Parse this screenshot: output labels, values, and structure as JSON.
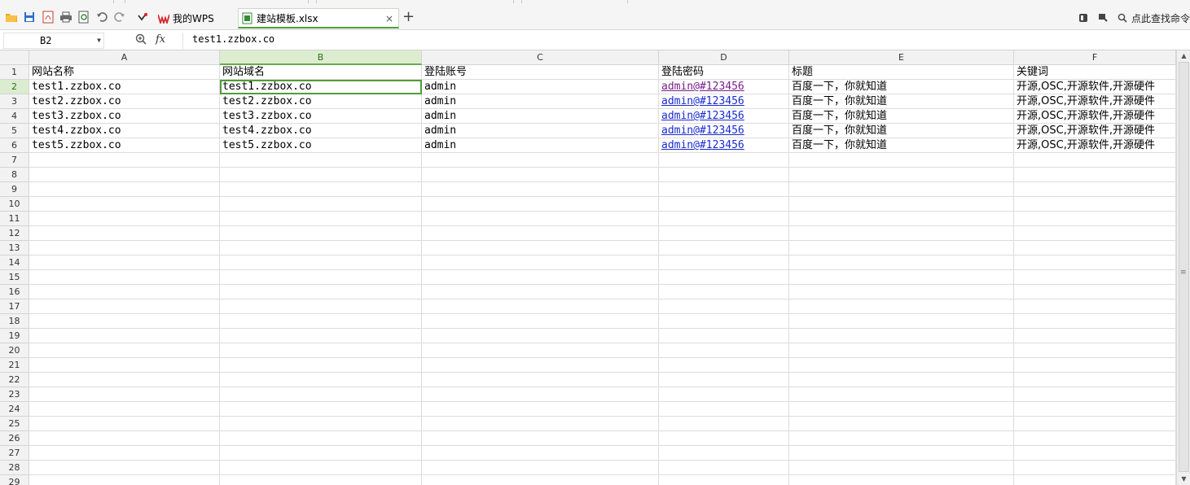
{
  "tabs": {
    "home_label": "我的WPS",
    "file_label": "建站模板.xlsx",
    "close_glyph": "×",
    "new_glyph": "+"
  },
  "toolbar": {
    "search_label": "点此查找命令"
  },
  "formula_bar": {
    "name_box": "B2",
    "fx_label": "fx",
    "content": "test1.zzbox.co"
  },
  "sheet": {
    "columns": [
      "A",
      "B",
      "C",
      "D",
      "E",
      "F"
    ],
    "selected_column": "B",
    "selected_row": 2,
    "active_cell": "B2",
    "row_numbers": [
      "1",
      "2",
      "3",
      "4",
      "5",
      "6",
      "7",
      "8",
      "9",
      "10",
      "11",
      "12",
      "13",
      "14",
      "15",
      "16",
      "17",
      "18",
      "19",
      "20",
      "21",
      "22",
      "23",
      "24",
      "25",
      "26",
      "27",
      "28",
      "29"
    ],
    "header_row": [
      "网站名称",
      "网站域名",
      "登陆账号",
      "登陆密码",
      "标题",
      "关键词"
    ],
    "rows": [
      [
        "test1.zzbox.co",
        "test1.zzbox.co",
        "admin",
        "admin@#123456",
        "百度一下，你就知道",
        "开源,OSC,开源软件,开源硬件"
      ],
      [
        "test2.zzbox.co",
        "test2.zzbox.co",
        "admin",
        "admin@#123456",
        "百度一下，你就知道",
        "开源,OSC,开源软件,开源硬件"
      ],
      [
        "test3.zzbox.co",
        "test3.zzbox.co",
        "admin",
        "admin@#123456",
        "百度一下，你就知道",
        "开源,OSC,开源软件,开源硬件"
      ],
      [
        "test4.zzbox.co",
        "test4.zzbox.co",
        "admin",
        "admin@#123456",
        "百度一下，你就知道",
        "开源,OSC,开源软件,开源硬件"
      ],
      [
        "test5.zzbox.co",
        "test5.zzbox.co",
        "admin",
        "admin@#123456",
        "百度一下，你就知道",
        "开源,OSC,开源软件,开源硬件"
      ]
    ]
  },
  "colors": {
    "accent_green": "#4f9d3a",
    "link_blue": "#1a2ad0",
    "link_visited": "#7a1f8a"
  },
  "icons": [
    "open-folder-icon",
    "save-icon",
    "pdf-export-icon",
    "print-icon",
    "print-preview-icon",
    "undo-icon",
    "redo-icon",
    "customize-icon",
    "wps-logo-icon",
    "spreadsheet-file-icon",
    "search-icon",
    "zoom-icon"
  ]
}
